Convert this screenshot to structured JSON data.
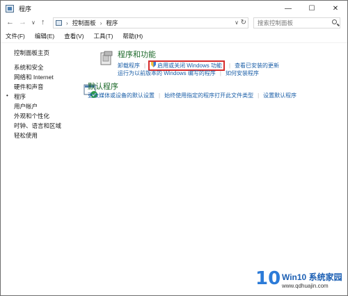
{
  "window": {
    "title": "程序"
  },
  "caption": {
    "minimize": "—",
    "maximize": "☐",
    "close": "✕"
  },
  "nav": {
    "back": "←",
    "forward": "→",
    "dropdown": "∨",
    "up": "↑"
  },
  "address": {
    "crumbs": [
      "控制面板",
      "程序"
    ],
    "separator": "›",
    "refresh": "↻"
  },
  "search": {
    "placeholder": "搜索控制面板"
  },
  "menu": [
    "文件(F)",
    "编辑(E)",
    "查看(V)",
    "工具(T)",
    "帮助(H)"
  ],
  "sidebar": {
    "items": [
      "控制面板主页",
      "系统和安全",
      "网络和 Internet",
      "硬件和声音",
      "程序",
      "用户帐户",
      "外观和个性化",
      "时钟、语言和区域",
      "轻松使用"
    ],
    "current_marker": "•"
  },
  "sections": [
    {
      "title": "程序和功能",
      "row1": [
        "卸载程序",
        "启用或关闭 Windows 功能",
        "查看已安装的更新"
      ],
      "row2": [
        "运行为以前版本的 Windows 编写的程序",
        "如何安装程序"
      ]
    },
    {
      "title": "默认程序",
      "row1": [
        "更改媒体或设备的默认设置",
        "始终使用指定的程序打开此文件类型",
        "设置默认程序"
      ]
    }
  ],
  "watermark": {
    "number": "10",
    "brand": "Win10 系统家园",
    "url": "www.qdhuajin.com"
  }
}
